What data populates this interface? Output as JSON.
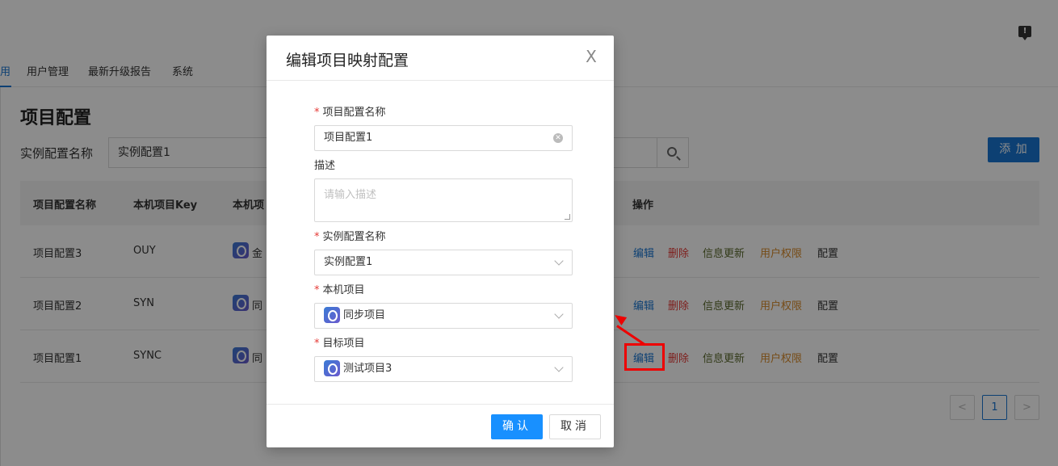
{
  "nav": {
    "items": [
      "用",
      "用户管理",
      "最新升级报告",
      "系统"
    ]
  },
  "page": {
    "title": "项目配置",
    "filter_label": "实例配置名称",
    "filter_value": "实例配置1",
    "add_label": "添 加"
  },
  "table": {
    "headers": [
      "项目配置名称",
      "本机项目Key",
      "本机项",
      "操作"
    ],
    "rows": [
      {
        "name": "项目配置3",
        "key": "OUY",
        "project": "金"
      },
      {
        "name": "项目配置2",
        "key": "SYN",
        "project": "同"
      },
      {
        "name": "项目配置1",
        "key": "SYNC",
        "project": "同"
      }
    ],
    "actions": [
      "编辑",
      "删除",
      "信息更新",
      "用户权限",
      "配置"
    ]
  },
  "pagination": {
    "prev": "<",
    "current": "1",
    "next": ">"
  },
  "modal": {
    "title": "编辑项目映射配置",
    "close": "X",
    "fields": {
      "name_label": "项目配置名称",
      "name_value": "项目配置1",
      "desc_label": "描述",
      "desc_placeholder": "请输入描述",
      "instance_label": "实例配置名称",
      "instance_value": "实例配置1",
      "local_label": "本机项目",
      "local_value": "同步项目",
      "target_label": "目标项目",
      "target_value": "测试项目3"
    },
    "required_mark": "*",
    "ok_label": "确认",
    "cancel_label": "取消"
  },
  "colors": {
    "primary": "#1976d2",
    "ok_button": "#1890ff",
    "delete": "#e53935",
    "info_update": "#5c6b2e",
    "permission": "#d88a2a",
    "annotation": "#ee0000"
  }
}
